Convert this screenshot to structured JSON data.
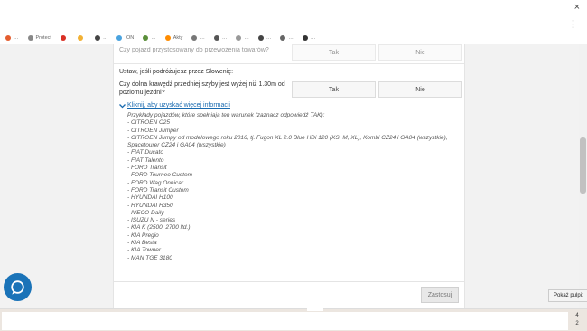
{
  "browser": {
    "close_glyph": "×",
    "menu_glyph": "⋮",
    "bookmarks": [
      {
        "label": "…",
        "color": "#e45d2f"
      },
      {
        "label": "Protect",
        "color": "#888888"
      },
      {
        "label": "",
        "color": "#d93025"
      },
      {
        "label": "",
        "color": "#f2b134"
      },
      {
        "label": "…",
        "color": "#444444"
      },
      {
        "label": "ION",
        "color": "#4aa3df"
      },
      {
        "label": "…",
        "color": "#5b8f3a"
      },
      {
        "label": "Akty",
        "color": "#ff8c00"
      },
      {
        "label": "…",
        "color": "#777777"
      },
      {
        "label": "…",
        "color": "#555555"
      },
      {
        "label": "…",
        "color": "#999999"
      },
      {
        "label": "…",
        "color": "#444444"
      },
      {
        "label": "…",
        "color": "#666666"
      },
      {
        "label": "…",
        "color": "#333333"
      }
    ]
  },
  "form": {
    "faded_question": "Czy pojazd przystosowany do przewożenia towarów?",
    "faded_yes": "Tak",
    "faded_no": "Nie",
    "section_title": "Ustaw, jeśli podróżujesz przez Słowenię:",
    "question": "Czy dolna krawędź przedniej szyby jest wyżej niż 1.30m od poziomu jezdni?",
    "yes": "Tak",
    "no": "Nie",
    "more_link": "Kliknij, aby uzyskać więcej informacji",
    "examples_intro": "Przykłady pojazdów, które spełniają ten warunek (zaznacz odpowiedź TAK):",
    "examples": [
      "- CITROEN C25",
      "- CITROEN Jumper",
      "- CITROEN Jumpy od modelowego roku 2016, tj. Fugon XL 2.0 Blue HDi 120 (XS, M, XL), Kombi CZ24 i GA04 (wszystkie), Spacetourer CZ24 i GA04 (wszystkie)",
      "- FIAT Ducato",
      "- FIAT Talento",
      "- FORD Transit",
      "- FORD Tourneo Custom",
      "- FORD Wag Onnicar",
      "- FORD Transit Custom",
      "- HYUNDAI H100",
      "- HYUNDAI H350",
      "- IVECO Daily",
      "- ISUZU N - series",
      "- KIA K (2500, 2700 ltd.)",
      "- KIA Pregio",
      "- KIA Besta",
      "- KIA Towner",
      "- MAN TGE 3180"
    ],
    "apply": "Zastosuj"
  },
  "desktop": {
    "tooltip": "Pokaż pulpit",
    "tray_text_1": "4",
    "tray_text_2": "2"
  },
  "colors": {
    "link": "#1a6bb0",
    "chat_bubble": "#1a73b8"
  }
}
